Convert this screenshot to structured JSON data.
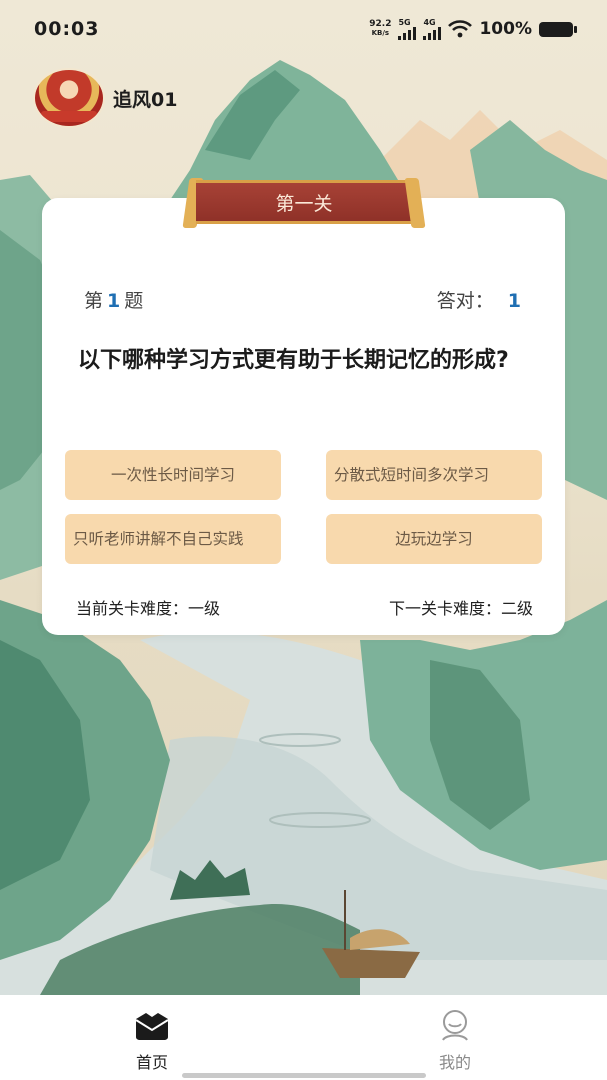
{
  "status_bar": {
    "time": "00:03",
    "net_speed_value": "92.2",
    "net_speed_unit": "KB/s",
    "signal_1_tag": "5G",
    "signal_2_tag": "4G",
    "battery_percent": "100%",
    "icons": [
      "signal-icon",
      "wifi-icon",
      "battery-icon"
    ]
  },
  "user": {
    "name": "追风01"
  },
  "quiz": {
    "level_title": "第一关",
    "question_prefix": "第",
    "question_number": "1",
    "question_suffix": "题",
    "correct_label": "答对：",
    "correct_count": "1",
    "question_text": "以下哪种学习方式更有助于长期记忆的形成?",
    "options": [
      {
        "label": "一次性长时间学习"
      },
      {
        "label": "分散式短时间多次学习"
      },
      {
        "label": "只听老师讲解不自己实践"
      },
      {
        "label": "边玩边学习"
      }
    ],
    "current_difficulty": "当前关卡难度：一级",
    "next_difficulty": "下一关卡难度：二级"
  },
  "bottom_nav": {
    "items": [
      {
        "label": "首页",
        "icon": "home-icon",
        "active": true
      },
      {
        "label": "我的",
        "icon": "profile-icon",
        "active": false
      }
    ]
  },
  "colors": {
    "banner": "#a74236",
    "option_bg": "#f8d9ad",
    "accent_number": "#1f6fb3"
  }
}
